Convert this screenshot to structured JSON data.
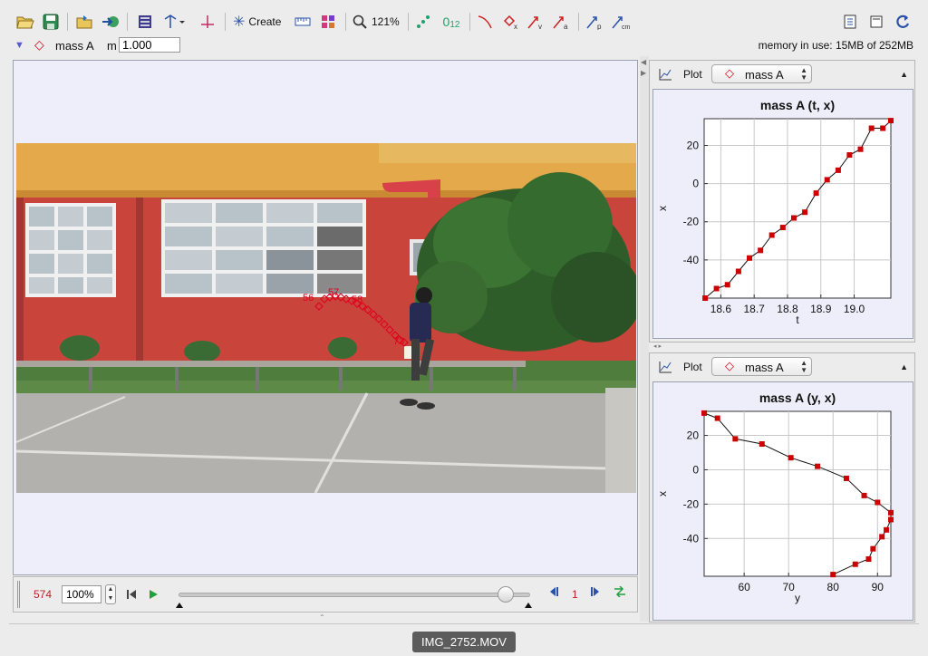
{
  "toolbar": {
    "create_label": "Create",
    "zoom_label": "121%",
    "coords_label": "0",
    "coords_sub": "12"
  },
  "track": {
    "name": "mass A",
    "mass_label": "m",
    "mass_value": "1.000",
    "memory": "memory in use: 15MB of 252MB",
    "marker_color": "#e0001b"
  },
  "video": {
    "frame_labels": [
      "56",
      "57",
      "58",
      "73"
    ],
    "trail_color": "#e0001b"
  },
  "player": {
    "frame_number": "574",
    "zoom": "100%",
    "step_size": "1",
    "slider_position": 0.93
  },
  "plots": [
    {
      "label": "Plot",
      "track_selector": "mass A",
      "chart_data": {
        "type": "line",
        "title": "mass A (t, x)",
        "xlabel": "t",
        "ylabel": "x",
        "xlim": [
          18.55,
          19.11
        ],
        "ylim": [
          -60,
          34
        ],
        "xticks": [
          "18.6",
          "18.7",
          "18.8",
          "18.9",
          "19.0"
        ],
        "yticks": [
          "20",
          "0",
          "-20",
          "-40"
        ],
        "grid": true,
        "series": [
          {
            "x": [
              18.553,
              18.587,
              18.62,
              18.653,
              18.686,
              18.719,
              18.753,
              18.786,
              18.819,
              18.852,
              18.886,
              18.919,
              18.952,
              18.986,
              19.019,
              19.052,
              19.086,
              19.11
            ],
            "y": [
              -60,
              -55,
              -53,
              -46,
              -39,
              -35,
              -27,
              -23,
              -18,
              -15,
              -5,
              2,
              7,
              15,
              18,
              29,
              29,
              33
            ]
          }
        ],
        "marker_color": "#cc0000"
      }
    },
    {
      "label": "Plot",
      "track_selector": "mass A",
      "chart_data": {
        "type": "line",
        "title": "mass A (y, x)",
        "xlabel": "y",
        "ylabel": "x",
        "xlim": [
          51,
          93
        ],
        "ylim": [
          -62,
          34
        ],
        "xticks": [
          "60",
          "70",
          "80",
          "90"
        ],
        "yticks": [
          "20",
          "0",
          "-20",
          "-40"
        ],
        "grid": true,
        "series": [
          {
            "x": [
              51,
              54,
              58,
              64,
              70.5,
              76.5,
              83,
              87,
              90,
              93,
              93,
              92,
              91,
              89,
              88,
              85,
              80
            ],
            "y": [
              33,
              30,
              18,
              15,
              7,
              2,
              -5,
              -15,
              -19,
              -25,
              -29,
              -35,
              -39,
              -46,
              -52,
              -55,
              -61
            ]
          }
        ],
        "marker_color": "#cc0000"
      }
    }
  ],
  "status": {
    "filename": "IMG_2752.MOV"
  }
}
